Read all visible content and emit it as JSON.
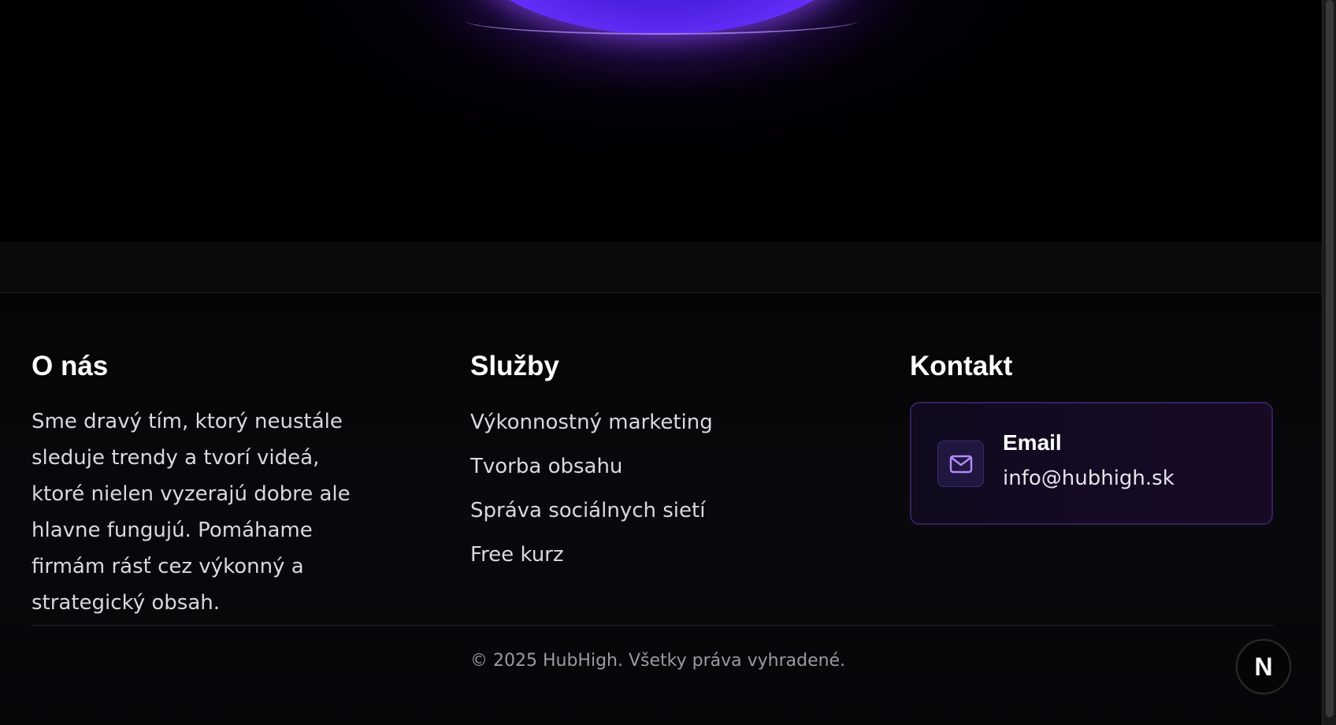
{
  "footer": {
    "about": {
      "title": "O nás",
      "text": "Sme dravý tím, ktorý neustále sleduje trendy a tvorí videá, ktoré nielen vyzerajú dobre ale hlavne fungujú. Pomáhame firmám rásť cez výkonný a strategický obsah."
    },
    "services": {
      "title": "Služby",
      "items": [
        {
          "label": "Výkonnostný marketing"
        },
        {
          "label": "Tvorba obsahu"
        },
        {
          "label": "Správa sociálnych sietí"
        },
        {
          "label": "Free kurz"
        }
      ]
    },
    "contact": {
      "title": "Kontakt",
      "email_label": "Email",
      "email_value": "info@hubhigh.sk",
      "icon": "mail-icon"
    },
    "copyright": "© 2025 HubHigh. Všetky práva vyhradené."
  },
  "badge": {
    "letter": "N"
  },
  "colors": {
    "accent": "#6a33ff",
    "background": "#000000",
    "card_border": "#35205f"
  }
}
